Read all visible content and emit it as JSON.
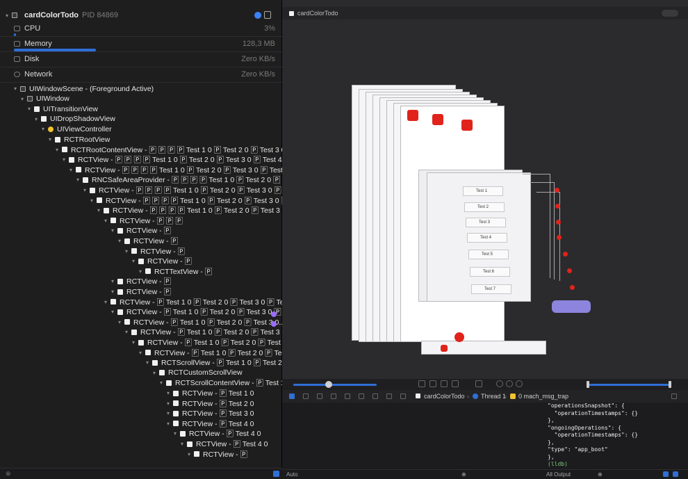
{
  "gauges": {
    "app_name": "cardColorTodo",
    "pid_label": "PID 84869",
    "cpu": {
      "label": "CPU",
      "value": "3%"
    },
    "memory": {
      "label": "Memory",
      "value": "128,3 MB"
    },
    "disk": {
      "label": "Disk",
      "value": "Zero KB/s"
    },
    "network": {
      "label": "Network",
      "value": "Zero KB/s"
    }
  },
  "tree": [
    {
      "text": "UIWindowScene - (Foreground Active)",
      "icon": "scene"
    },
    {
      "text": "UIWindow",
      "icon": "window"
    },
    {
      "text": "UITransitionView",
      "icon": "view"
    },
    {
      "text": "UIDropShadowView",
      "icon": "view"
    },
    {
      "text": "UIViewController",
      "icon": "controller"
    },
    {
      "text": "RCTRootView",
      "icon": "view"
    },
    {
      "text": "RCTRootContentView - 🄿 🄿 🄿 🄿 Test 1 0 🄿 Test 2 0 🄿 Test 3 0 🄿...",
      "icon": "view"
    },
    {
      "text": "RCTView - 🄿 🄿 🄿 🄿 Test 1 0 🄿 Test 2 0 🄿 Test 3 0 🄿 Test 4 0...",
      "icon": "view"
    },
    {
      "text": "RCTView - 🄿 🄿 🄿 🄿 Test 1 0 🄿 Test 2 0 🄿 Test 3 0 🄿 Test 4 0...",
      "icon": "view"
    },
    {
      "text": "RNCSafeAreaProvider - 🄿 🄿 🄿 🄿 Test 1 0 🄿 Test 2 0 🄿 Test...",
      "icon": "view"
    },
    {
      "text": "RCTView - 🄿 🄿 🄿 🄿 Test 1 0 🄿 Test 2 0 🄿 Test 3 0 🄿 Tes...",
      "icon": "view"
    },
    {
      "text": "RCTView - 🄿 🄿 🄿 🄿 Test 1 0 🄿 Test 2 0 🄿 Test 3 0 🄿 T...",
      "icon": "view"
    },
    {
      "text": "RCTView - 🄿 🄿 🄿 🄿 Test 1 0 🄿 Test 2 0 🄿 Test 3 0...",
      "icon": "view"
    },
    {
      "text": "RCTView - 🄿 🄿 🄿",
      "icon": "view"
    },
    {
      "text": "RCTView - 🄿",
      "icon": "view"
    },
    {
      "text": "RCTView - 🄿",
      "icon": "view"
    },
    {
      "text": "RCTView - 🄿",
      "icon": "view"
    },
    {
      "text": "RCTView - 🄿",
      "icon": "view"
    },
    {
      "text": "RCTTextView - 🄿",
      "icon": "view"
    },
    {
      "text": "RCTView - 🄿",
      "icon": "view"
    },
    {
      "text": "RCTView - 🄿",
      "icon": "view"
    },
    {
      "text": "RCTView - 🄿 Test 1 0 🄿 Test 2 0 🄿 Test 3 0 🄿 Test...",
      "icon": "view"
    },
    {
      "text": "RCTView - 🄿 Test 1 0 🄿 Test 2 0 🄿 Test 3 0 🄿 T...",
      "icon": "view"
    },
    {
      "text": "RCTView - 🄿 Test 1 0 🄿 Test 2 0 🄿 Test 3 0...",
      "icon": "view"
    },
    {
      "text": "RCTView - 🄿 Test 1 0 🄿 Test 2 0 🄿 Test 3 0...",
      "icon": "view"
    },
    {
      "text": "RCTView - 🄿 Test 1 0 🄿 Test 2 0 🄿 Test 3 0...",
      "icon": "view"
    },
    {
      "text": "RCTView - 🄿 Test 1 0 🄿 Test 2 0 🄿 Test...",
      "icon": "view"
    },
    {
      "text": "RCTScrollView - 🄿 Test 1 0 🄿 Test 2 0...",
      "icon": "view"
    },
    {
      "text": "RCTCustomScrollView",
      "icon": "view"
    },
    {
      "text": "RCTScrollContentView - 🄿 Test 1 0...",
      "icon": "view"
    },
    {
      "text": "RCTView - 🄿 Test 1 0",
      "icon": "view"
    },
    {
      "text": "RCTView - 🄿 Test 2 0",
      "icon": "view"
    },
    {
      "text": "RCTView - 🄿 Test 3 0",
      "icon": "view"
    },
    {
      "text": "RCTView - 🄿 Test 4 0",
      "icon": "view"
    },
    {
      "text": "RCTView - 🄿 Test 4 0",
      "icon": "view"
    },
    {
      "text": "RCTView - 🄿 Test 4 0",
      "icon": "view"
    },
    {
      "text": "RCTView - 🄿",
      "icon": "view"
    }
  ],
  "canvas": {
    "tab_title": "cardColorTodo",
    "cards": [
      "Test 1",
      "Test 2",
      "Test 3",
      "Test 4",
      "Test 5",
      "Test 6",
      "Test 7"
    ]
  },
  "jumpbar": {
    "app": "cardColorTodo",
    "thread": "Thread 1",
    "frame": "0 mach_msg_trap"
  },
  "console_lines": [
    "\"operationsSnapshot\": {",
    "  \"operationTimestamps\": {}",
    "},",
    "\"ongoingOperations\": {",
    "  \"operationTimestamps\": {}",
    "},",
    "\"type\": \"app_boot\"",
    "},",
    "(lldb)"
  ],
  "statusbar": {
    "auto": "Auto",
    "output": "All Output"
  },
  "colors": {
    "accent": "#2f6fd6",
    "red_marker": "#e0231b",
    "lavender": "#8d84de"
  }
}
